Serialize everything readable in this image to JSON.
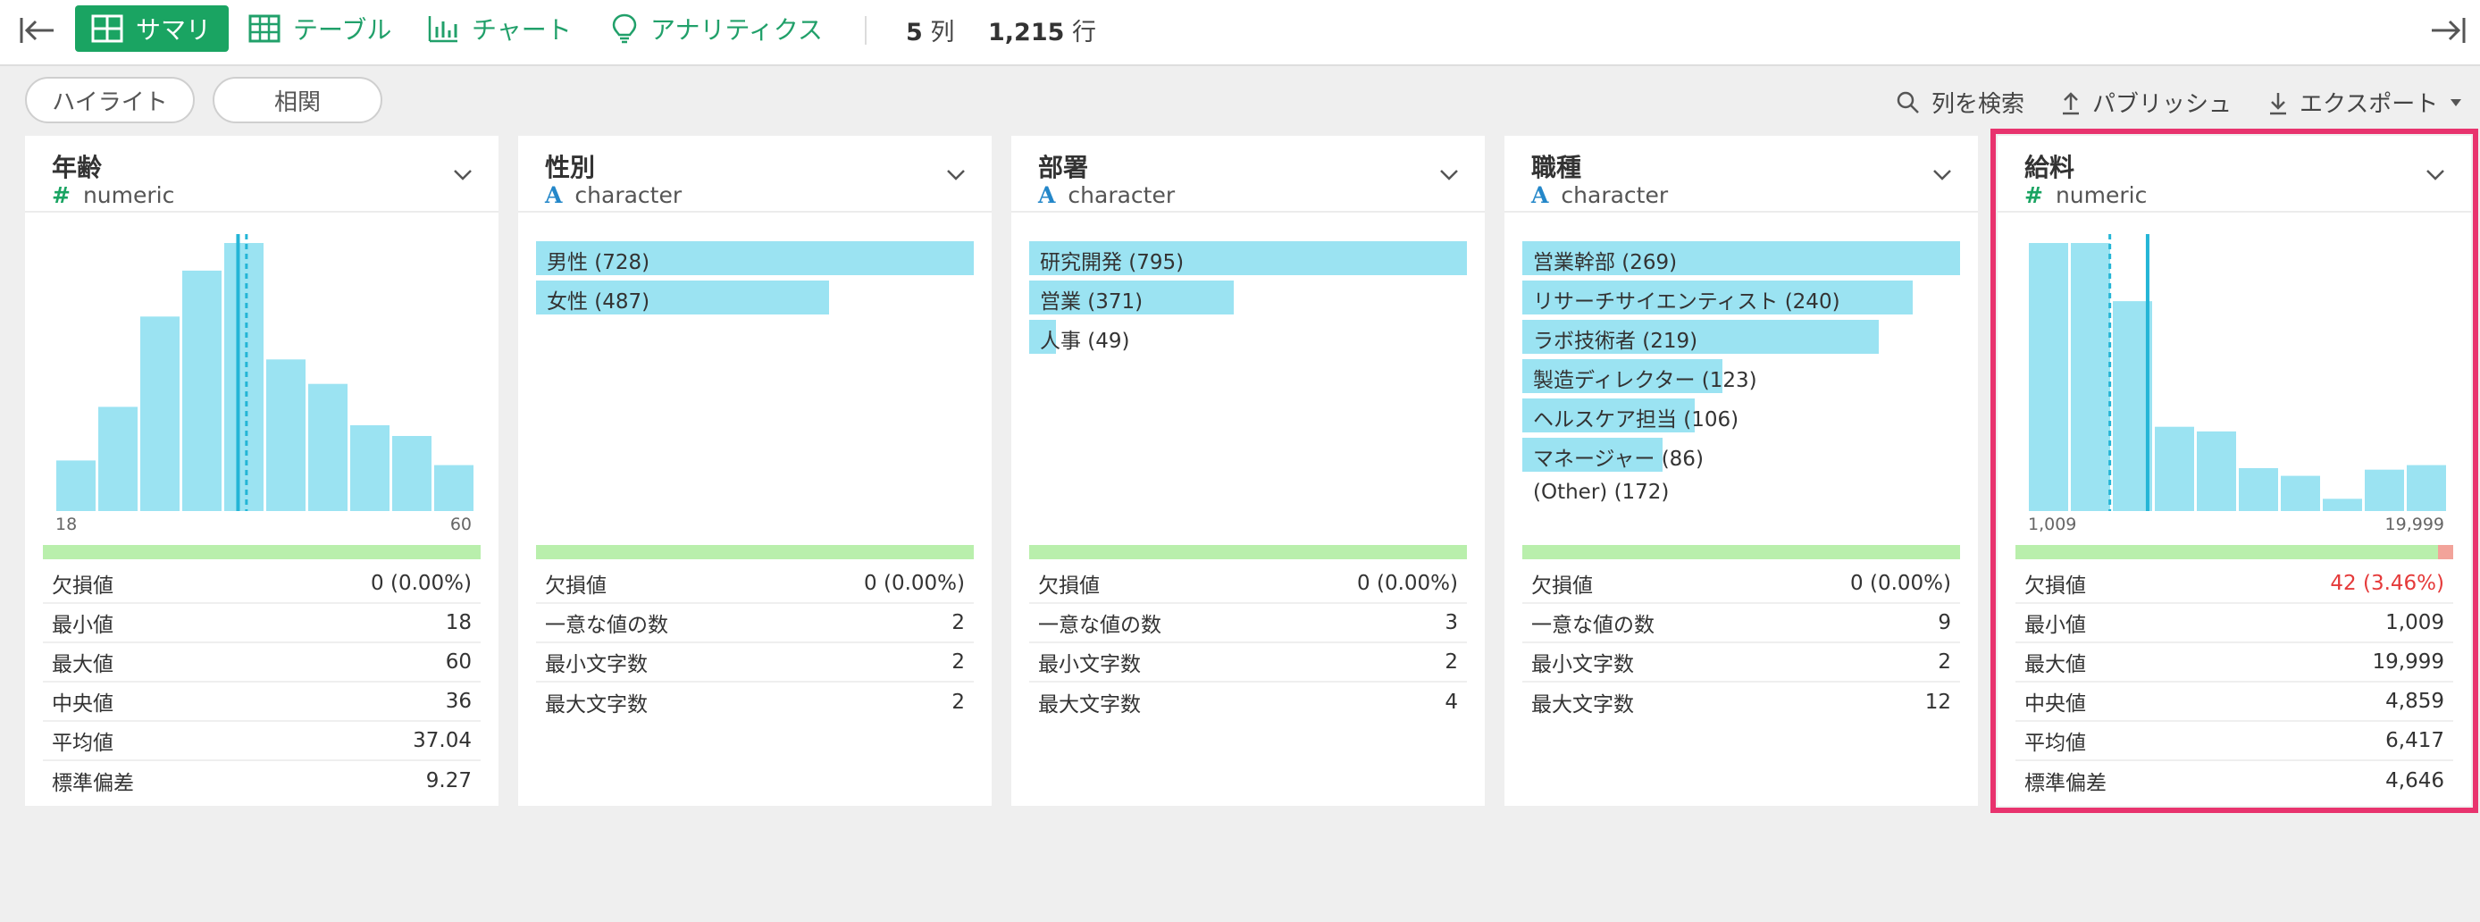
{
  "toolbar": {
    "tabs": [
      {
        "label": "サマリ",
        "icon": "grid-icon"
      },
      {
        "label": "テーブル",
        "icon": "table-icon"
      },
      {
        "label": "チャート",
        "icon": "bar-chart-icon"
      },
      {
        "label": "アナリティクス",
        "icon": "lightbulb-icon"
      }
    ],
    "columns_count": "5",
    "columns_unit": "列",
    "rows_count": "1,215",
    "rows_unit": "行",
    "accent": "#1aa462"
  },
  "subbar": {
    "highlight": "ハイライト",
    "correlation": "相関",
    "search_columns": "列を検索",
    "publish": "パブリッシュ",
    "export": "エクスポート"
  },
  "columns": [
    {
      "name": "年齢",
      "type_symbol": "#",
      "type": "numeric",
      "hist": {
        "values": [
          33,
          68,
          127,
          157,
          175,
          99,
          83,
          56,
          49,
          30
        ],
        "mean_frac": 0.435,
        "median_frac": 0.455,
        "min": "18",
        "max": "60"
      },
      "missing_frac": 0,
      "stats": [
        {
          "label": "欠損値",
          "value": "0 (0.00%)"
        },
        {
          "label": "最小値",
          "value": "18"
        },
        {
          "label": "最大値",
          "value": "60"
        },
        {
          "label": "中央値",
          "value": "36"
        },
        {
          "label": "平均値",
          "value": "37.04"
        },
        {
          "label": "標準偏差",
          "value": "9.27"
        }
      ]
    },
    {
      "name": "性別",
      "type_symbol": "A",
      "type": "character",
      "bars": [
        {
          "label": "男性 (728)",
          "count": 728
        },
        {
          "label": "女性 (487)",
          "count": 487
        }
      ],
      "missing_frac": 0,
      "stats": [
        {
          "label": "欠損値",
          "value": "0 (0.00%)"
        },
        {
          "label": "一意な値の数",
          "value": "2"
        },
        {
          "label": "最小文字数",
          "value": "2"
        },
        {
          "label": "最大文字数",
          "value": "2"
        }
      ]
    },
    {
      "name": "部署",
      "type_symbol": "A",
      "type": "character",
      "bars": [
        {
          "label": "研究開発 (795)",
          "count": 795
        },
        {
          "label": "営業 (371)",
          "count": 371
        },
        {
          "label": "人事 (49)",
          "count": 49
        }
      ],
      "missing_frac": 0,
      "stats": [
        {
          "label": "欠損値",
          "value": "0 (0.00%)"
        },
        {
          "label": "一意な値の数",
          "value": "3"
        },
        {
          "label": "最小文字数",
          "value": "2"
        },
        {
          "label": "最大文字数",
          "value": "4"
        }
      ]
    },
    {
      "name": "職種",
      "type_symbol": "A",
      "type": "character",
      "bars": [
        {
          "label": "営業幹部 (269)",
          "count": 269
        },
        {
          "label": "リサーチサイエンティスト (240)",
          "count": 240
        },
        {
          "label": "ラボ技術者 (219)",
          "count": 219
        },
        {
          "label": "製造ディレクター (123)",
          "count": 123
        },
        {
          "label": "ヘルスケア担当 (106)",
          "count": 106
        },
        {
          "label": "マネージャー (86)",
          "count": 86
        },
        {
          "label": "(Other) (172)",
          "count": 0
        }
      ],
      "missing_frac": 0,
      "stats": [
        {
          "label": "欠損値",
          "value": "0 (0.00%)"
        },
        {
          "label": "一意な値の数",
          "value": "9"
        },
        {
          "label": "最小文字数",
          "value": "2"
        },
        {
          "label": "最大文字数",
          "value": "12"
        }
      ]
    },
    {
      "name": "給料",
      "type_symbol": "#",
      "type": "numeric",
      "hist": {
        "values": [
          175,
          175,
          137,
          55,
          52,
          28,
          23,
          8,
          27,
          30
        ],
        "mean_frac": 0.285,
        "median_frac": 0.195,
        "min": "1,009",
        "max": "19,999"
      },
      "missing_frac": 0.0346,
      "stats": [
        {
          "label": "欠損値",
          "value": "42 (3.46%)",
          "alert": true
        },
        {
          "label": "最小値",
          "value": "1,009"
        },
        {
          "label": "最大値",
          "value": "19,999"
        },
        {
          "label": "中央値",
          "value": "4,859"
        },
        {
          "label": "平均値",
          "value": "6,417"
        },
        {
          "label": "標準偏差",
          "value": "4,646"
        }
      ]
    }
  ]
}
